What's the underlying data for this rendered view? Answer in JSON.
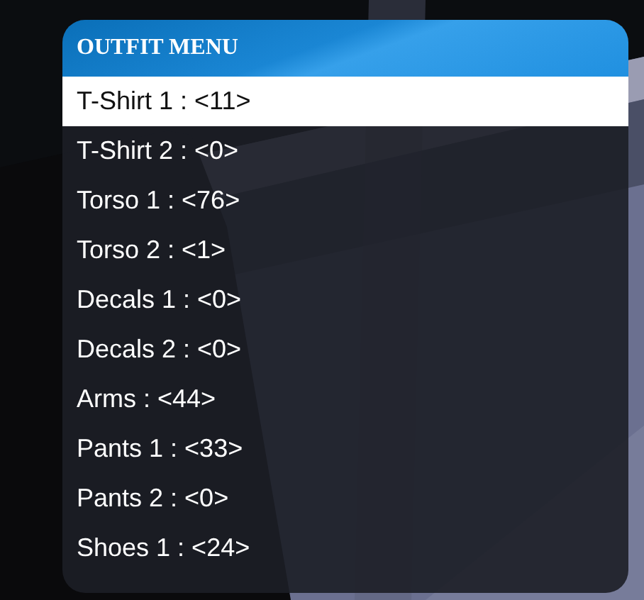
{
  "menu": {
    "title": "OUTFIT MENU",
    "items": [
      {
        "label": "T-Shirt 1 : <11>",
        "selected": true
      },
      {
        "label": "T-Shirt 2 : <0>",
        "selected": false
      },
      {
        "label": "Torso 1 : <76>",
        "selected": false
      },
      {
        "label": "Torso 2 : <1>",
        "selected": false
      },
      {
        "label": "Decals 1 : <0>",
        "selected": false
      },
      {
        "label": "Decals 2 : <0>",
        "selected": false
      },
      {
        "label": "Arms : <44>",
        "selected": false
      },
      {
        "label": "Pants 1 : <33>",
        "selected": false
      },
      {
        "label": "Pants 2 : <0>",
        "selected": false
      },
      {
        "label": "Shoes 1 : <24>",
        "selected": false
      }
    ]
  }
}
